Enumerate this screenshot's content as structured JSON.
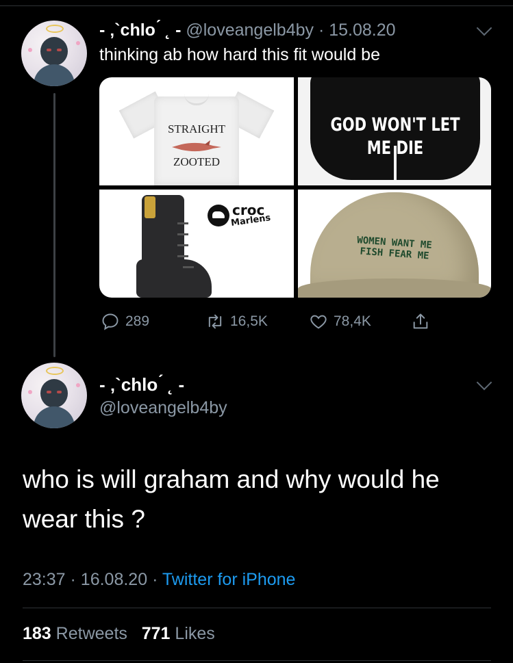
{
  "tweet1": {
    "display_name": "- ‚`chlo ́ ˛ -",
    "handle": "@loveangelb4by",
    "separator": "·",
    "date": "15.08.20",
    "text": "thinking ab how hard this fit would be",
    "images": {
      "shirt": {
        "line1": "STRAIGHT",
        "line2": "ZOOTED"
      },
      "shorts": {
        "line1": "GOD WON'T LET",
        "line2": "ME DIE"
      },
      "boots": {
        "brand_line1": "croc",
        "brand_line2": "Marlens"
      },
      "cap": {
        "line1": "WOMEN WANT ME",
        "line2": "FISH FEAR ME"
      }
    },
    "actions": {
      "replies": "289",
      "retweets": "16,5K",
      "likes": "78,4K"
    }
  },
  "tweet2": {
    "display_name": "- ‚`chlo ́ ˛ -",
    "handle": "@loveangelb4by",
    "text": "who is will graham and why would he wear this ?",
    "time": "23:37",
    "date": "16.08.20",
    "separator": "·",
    "source": "Twitter for iPhone",
    "retweet_count": "183",
    "retweet_label": "Retweets",
    "like_count": "771",
    "like_label": "Likes"
  },
  "colors": {
    "background": "#000000",
    "muted": "#8b98a5",
    "link": "#1d9bf0",
    "divider": "#2f3336"
  },
  "icons": [
    "reply-icon",
    "retweet-icon",
    "like-icon",
    "share-icon",
    "chevron-down-icon"
  ]
}
